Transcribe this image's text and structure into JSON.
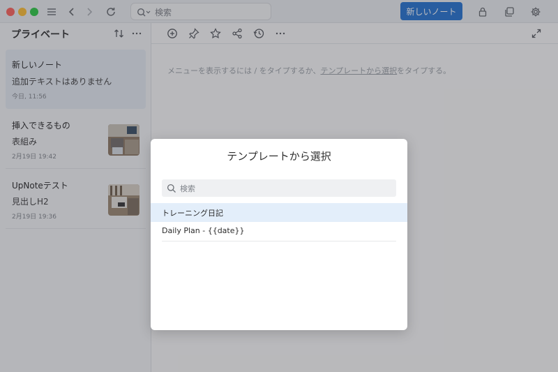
{
  "titlebar": {
    "search_placeholder": "検索",
    "new_note_label": "新しいノート",
    "icons": [
      "sidebar-toggle-icon",
      "back-icon",
      "forward-icon",
      "refresh-icon",
      "lock-icon",
      "copy-window-icon",
      "gear-icon"
    ]
  },
  "notelist": {
    "title": "プライベート",
    "notes": [
      {
        "title": "新しいノート",
        "subtitle": "追加テキストはありません",
        "date": "今日, 11:56",
        "selected": true
      },
      {
        "title": "挿入できるもの",
        "subtitle": "表組み",
        "date": "2月19日 19:42",
        "thumbnail": "room-photo"
      },
      {
        "title": "UpNoteテスト",
        "subtitle": "見出しH2",
        "date": "2月19日 19:36",
        "thumbnail": "room-photo"
      }
    ]
  },
  "editor": {
    "hint_prefix": "メニューを表示するには / をタイプするか、",
    "hint_link": "テンプレートから選択",
    "hint_suffix": "をタイプする。"
  },
  "modal": {
    "title": "テンプレートから選択",
    "search_placeholder": "検索",
    "templates": [
      {
        "label": "トレーニング日記",
        "active": true
      },
      {
        "label": "Daily Plan - {{date}}",
        "active": false
      }
    ]
  },
  "colors": {
    "accent": "#1f6fd1",
    "selected_note_bg": "#e6ebf3",
    "active_template_bg": "#e3eefa"
  }
}
